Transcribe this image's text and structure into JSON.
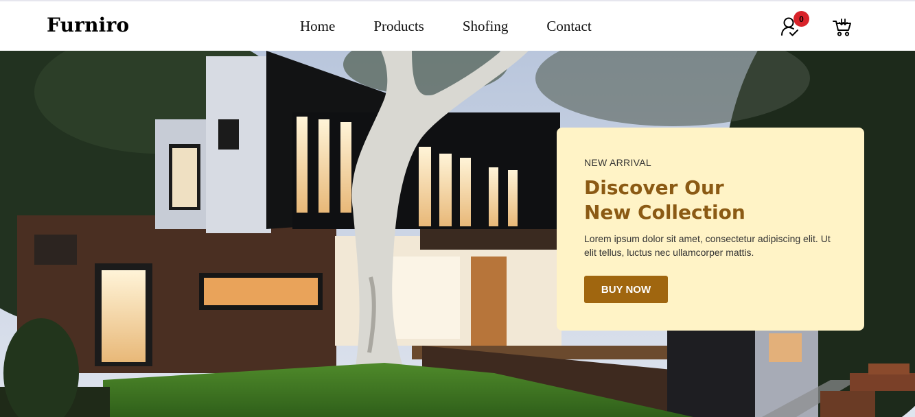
{
  "brand": {
    "name": "Furniro"
  },
  "nav": {
    "items": [
      {
        "label": "Home"
      },
      {
        "label": "Products"
      },
      {
        "label": "Shofing"
      },
      {
        "label": "Contact"
      }
    ]
  },
  "header_icons": {
    "user_icon": "user-check-icon",
    "cart_icon": "shopping-cart-icon",
    "notification_count": "0"
  },
  "hero": {
    "image": "modern-house-exterior",
    "card": {
      "eyebrow": "NEW ARRIVAL",
      "heading_line1": "Discover Our",
      "heading_line2": "New Collection",
      "description": "Lorem ipsum dolor sit amet, consectetur adipiscing elit. Ut elit tellus, luctus nec ullamcorper mattis.",
      "button_label": "BUY NOW"
    }
  },
  "colors": {
    "card_bg": "#fff3c6",
    "heading": "#8b5a14",
    "button": "#a0660f",
    "badge": "#d8232a"
  }
}
